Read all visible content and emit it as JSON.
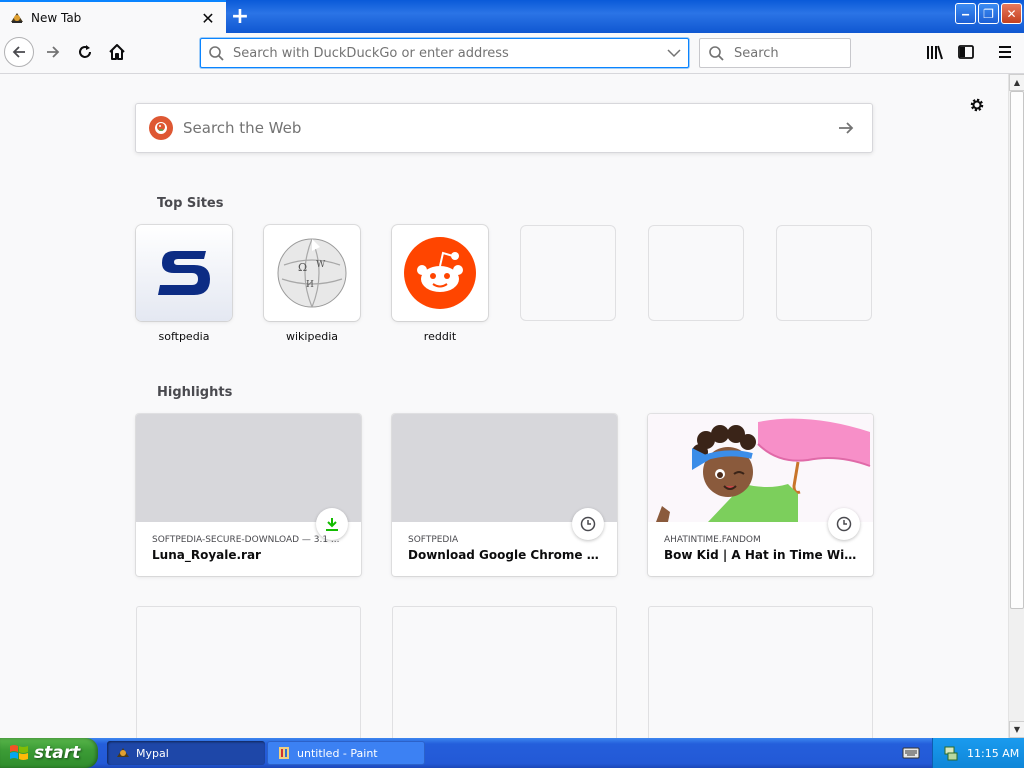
{
  "browser": {
    "tab": {
      "title": "New Tab",
      "close_label": "✕"
    },
    "new_tab_label": "+",
    "window_controls": {
      "minimize": "‒",
      "maximize": "❐",
      "close": "✕"
    },
    "url_placeholder": "Search with DuckDuckGo or enter address",
    "search_placeholder": "Search",
    "icons": [
      "back-icon",
      "forward-icon",
      "reload-icon",
      "home-icon",
      "search-icon",
      "library-icon",
      "sidebar-icon",
      "hamburger-menu-icon",
      "gear-icon"
    ]
  },
  "newtab": {
    "web_search_placeholder": "Search the Web",
    "top_sites_title": "Top Sites",
    "top_sites": [
      {
        "label": "softpedia"
      },
      {
        "label": "wikipedia"
      },
      {
        "label": "reddit"
      },
      {
        "label": ""
      },
      {
        "label": ""
      },
      {
        "label": ""
      }
    ],
    "highlights_title": "Highlights",
    "highlights": [
      {
        "context": "SOFTPEDIA-SECURE-DOWNLOAD — 3.1 ...",
        "title": "Luna_Royale.rar",
        "badge": "download-icon"
      },
      {
        "context": "SOFTPEDIA",
        "title": "Download Google Chrome Back...",
        "badge": "clock-icon"
      },
      {
        "context": "AHATINTIME.FANDOM",
        "title": "Bow Kid | A Hat in Time Wiki | Fa...",
        "badge": "clock-icon"
      }
    ]
  },
  "taskbar": {
    "start_label": "start",
    "tasks": [
      {
        "label": "Mypal"
      },
      {
        "label": "untitled - Paint"
      }
    ],
    "clock": "11:15 AM"
  },
  "colors": {
    "accent": "#0a84ff",
    "xp_blue": "#245edb",
    "xp_green": "#3c9c36",
    "reddit": "#ff4500",
    "softpedia": "#0c2c84",
    "download": "#12bc00"
  }
}
